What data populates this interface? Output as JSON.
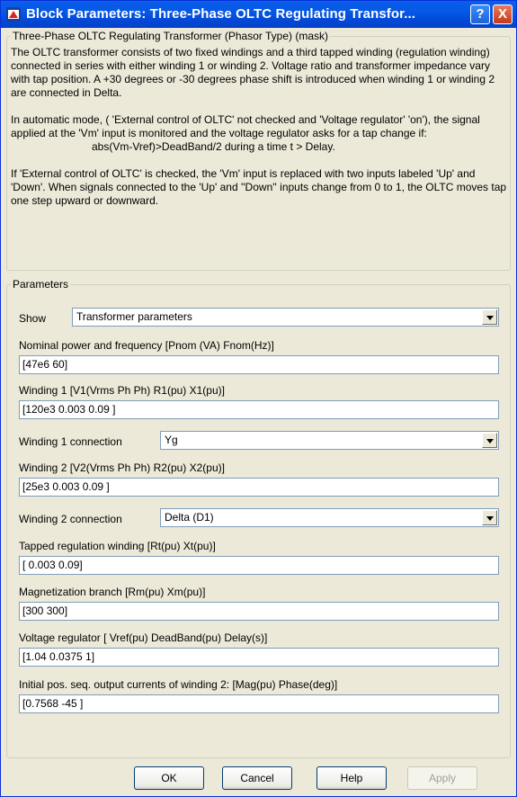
{
  "window": {
    "title": "Block Parameters: Three-Phase OLTC Regulating Transfor...",
    "help_glyph": "?",
    "close_glyph": "X"
  },
  "mask": {
    "legend": "Three-Phase OLTC Regulating Transformer (Phasor Type) (mask)",
    "para1": "The OLTC transformer consists of two fixed windings and a third tapped winding (regulation winding) connected in series with either winding 1 or winding 2. Voltage ratio and  transformer impedance vary with  tap position. A +30  degrees or -30 degrees phase shift  is introduced when winding 1 or winding 2 are connected in Delta.",
    "para2": "In automatic mode, ( 'External control of OLTC' not checked and 'Voltage regulator' 'on'), the signal applied at the 'Vm' input is monitored and the voltage regulator asks for a tap change if:",
    "formula": "abs(Vm-Vref)>DeadBand/2  during a time  t > Delay.",
    "para3": "If 'External control of OLTC' is checked, the 'Vm' input is replaced with two inputs labeled 'Up' and 'Down'. When signals connected to the 'Up' and ''Down'' inputs change from 0 to 1, the OLTC moves tap one step upward or downward."
  },
  "params": {
    "legend": "Parameters",
    "show_label": "Show",
    "show_value": "Transformer parameters",
    "nominal_label": "Nominal power and frequency [Pnom (VA) Fnom(Hz)]",
    "nominal_value": "[47e6  60]",
    "w1_label": "Winding 1 [V1(Vrms Ph Ph)  R1(pu)  X1(pu)]",
    "w1_value": "[120e3  0.003 0.09 ]",
    "w1_conn_label": "Winding 1 connection",
    "w1_conn_value": "Yg",
    "w2_label": "Winding 2 [V2(Vrms Ph Ph)  R2(pu)  X2(pu)]",
    "w2_value": "[25e3   0.003 0.09 ]",
    "w2_conn_label": "Winding 2 connection",
    "w2_conn_value": "Delta (D1)",
    "tapped_label": "Tapped regulation winding [Rt(pu)  Xt(pu)]",
    "tapped_value": "[ 0.003 0.09]",
    "mag_label": "Magnetization branch [Rm(pu)  Xm(pu)]",
    "mag_value": "[300 300]",
    "vreg_label": "Voltage regulator [ Vref(pu) DeadBand(pu)  Delay(s)]",
    "vreg_value": "[1.04   0.0375 1]",
    "init_label": "Initial pos. seq. output currents of winding 2:  [Mag(pu)  Phase(deg)]",
    "init_value": "[0.7568   -45  ]"
  },
  "buttons": {
    "ok": "OK",
    "cancel": "Cancel",
    "help": "Help",
    "apply": "Apply"
  }
}
